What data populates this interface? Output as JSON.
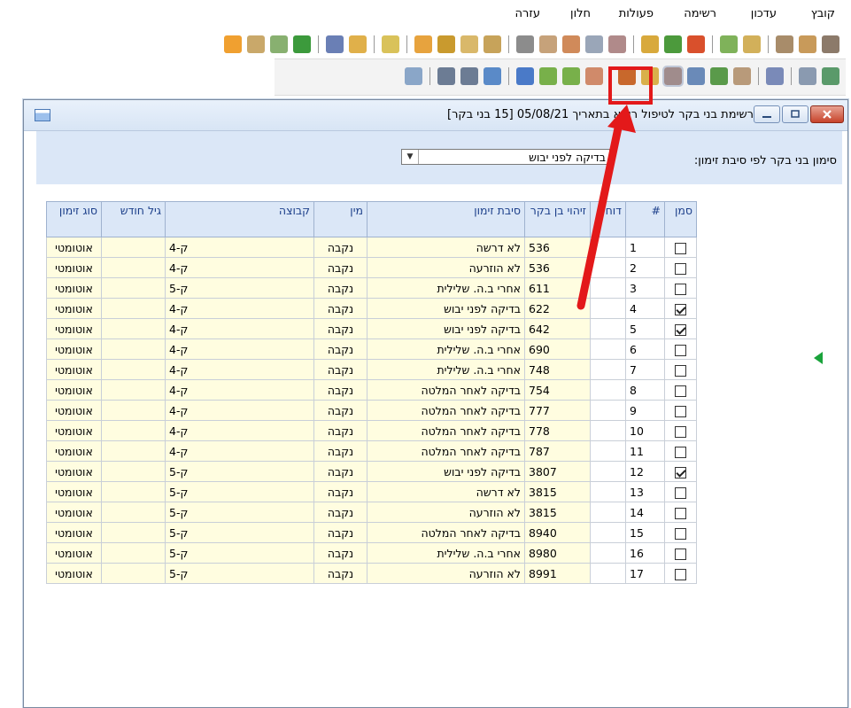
{
  "menu": [
    "קובץ",
    "עדכון",
    "רשימה",
    "פעולות",
    "חלון",
    "עזרה"
  ],
  "window": {
    "title": "רשימת בני בקר לטיפול רופא בתאריך 05/08/21 [15 בני בקר]"
  },
  "filter": {
    "label": "סימון בני בקר לפי סיבת זימון:",
    "selected": "בדיקה לפני יבוש"
  },
  "columns": {
    "mark": "סמן",
    "num": "#",
    "report": "דוח",
    "cattle_id": "זיהוי בן בקר",
    "reason": "סיבת זימון",
    "sex": "מין",
    "group": "קבוצה",
    "age": "גיל חודש",
    "type": "סוג זימון"
  },
  "rows": [
    {
      "checked": false,
      "num": "1",
      "id": "536",
      "reason": "לא דרשה",
      "sex": "נקבה",
      "group": "ק-4",
      "type": "אוטומטי"
    },
    {
      "checked": false,
      "num": "2",
      "id": "536",
      "reason": "לא הוזרעה",
      "sex": "נקבה",
      "group": "ק-4",
      "type": "אוטומטי"
    },
    {
      "checked": false,
      "num": "3",
      "id": "611",
      "reason": "אחרי ב.ה. שלילית",
      "sex": "נקבה",
      "group": "ק-5",
      "type": "אוטומטי"
    },
    {
      "checked": true,
      "num": "4",
      "id": "622",
      "reason": "בדיקה לפני יבוש",
      "sex": "נקבה",
      "group": "ק-4",
      "type": "אוטומטי"
    },
    {
      "checked": true,
      "num": "5",
      "id": "642",
      "reason": "בדיקה לפני יבוש",
      "sex": "נקבה",
      "group": "ק-4",
      "type": "אוטומטי"
    },
    {
      "checked": false,
      "num": "6",
      "id": "690",
      "reason": "אחרי ב.ה. שלילית",
      "sex": "נקבה",
      "group": "ק-4",
      "type": "אוטומטי"
    },
    {
      "checked": false,
      "num": "7",
      "id": "748",
      "reason": "אחרי ב.ה. שלילית",
      "sex": "נקבה",
      "group": "ק-4",
      "type": "אוטומטי"
    },
    {
      "checked": false,
      "num": "8",
      "id": "754",
      "reason": "בדיקה לאחר המלטה",
      "sex": "נקבה",
      "group": "ק-4",
      "type": "אוטומטי"
    },
    {
      "checked": false,
      "num": "9",
      "id": "777",
      "reason": "בדיקה לאחר המלטה",
      "sex": "נקבה",
      "group": "ק-4",
      "type": "אוטומטי"
    },
    {
      "checked": false,
      "num": "10",
      "id": "778",
      "reason": "בדיקה לאחר המלטה",
      "sex": "נקבה",
      "group": "ק-4",
      "type": "אוטומטי"
    },
    {
      "checked": false,
      "num": "11",
      "id": "787",
      "reason": "בדיקה לאחר המלטה",
      "sex": "נקבה",
      "group": "ק-4",
      "type": "אוטומטי"
    },
    {
      "checked": true,
      "num": "12",
      "id": "3807",
      "reason": "בדיקה לפני יבוש",
      "sex": "נקבה",
      "group": "ק-5",
      "type": "אוטומטי"
    },
    {
      "checked": false,
      "num": "13",
      "id": "3815",
      "reason": "לא דרשה",
      "sex": "נקבה",
      "group": "ק-5",
      "type": "אוטומטי"
    },
    {
      "checked": false,
      "num": "14",
      "id": "3815",
      "reason": "לא הוזרעה",
      "sex": "נקבה",
      "group": "ק-5",
      "type": "אוטומטי"
    },
    {
      "checked": false,
      "num": "15",
      "id": "8940",
      "reason": "בדיקה לאחר המלטה",
      "sex": "נקבה",
      "group": "ק-5",
      "type": "אוטומטי"
    },
    {
      "checked": false,
      "num": "16",
      "id": "8980",
      "reason": "אחרי ב.ה. שלילית",
      "sex": "נקבה",
      "group": "ק-5",
      "type": "אוטומטי"
    },
    {
      "checked": false,
      "num": "17",
      "id": "8991",
      "reason": "לא הוזרעה",
      "sex": "נקבה",
      "group": "ק-5",
      "type": "אוטומטי"
    }
  ],
  "colors": {
    "annotation_red": "#e3191a",
    "row_pointer_green": "#1aa33b",
    "cell_yellow": "#fffde0",
    "header_blue": "#dbe7f7"
  }
}
